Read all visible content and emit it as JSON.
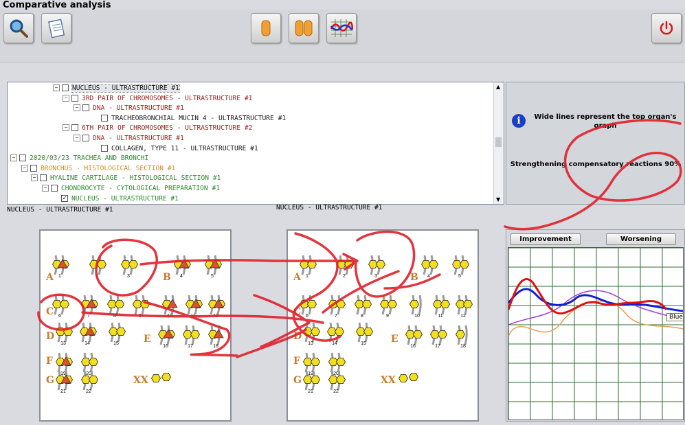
{
  "window": {
    "title": "Comparative analysis"
  },
  "toolbar": {
    "buttons": [
      {
        "name": "search-button",
        "icon": "magnifier-icon"
      },
      {
        "name": "notes-button",
        "icon": "notepad-icon"
      },
      {
        "name": "single-view-button",
        "icon": "single-capsule-icon"
      },
      {
        "name": "dual-view-button",
        "icon": "double-capsule-icon"
      },
      {
        "name": "graph-view-button",
        "icon": "wave-graph-icon"
      },
      {
        "name": "power-button",
        "icon": "power-icon"
      }
    ]
  },
  "tree": {
    "rows": [
      {
        "text": "NUCLEUS - ULTRASTRUCTURE #1",
        "color": "#1a1a1a",
        "indent": 66,
        "expander": true,
        "selected": true
      },
      {
        "text": "3RD PAIR OF CHROMOSOMES - ULTRASTRUCTURE #1",
        "color": "#a32020",
        "indent": 80,
        "expander": true
      },
      {
        "text": "DNA - ULTRASTRUCTURE #1",
        "color": "#a32020",
        "indent": 96,
        "expander": true
      },
      {
        "text": "TRACHEOBRONCHIAL MUCIN 4 - ULTRASTRUCTURE #1",
        "color": "#1a1a1a",
        "indent": 124,
        "expander": false
      },
      {
        "text": "6TH PAIR OF CHROMOSOMES - ULTRASTRUCTURE #2",
        "color": "#a32020",
        "indent": 80,
        "expander": true
      },
      {
        "text": "DNA - ULTRASTRUCTURE #1",
        "color": "#a32020",
        "indent": 96,
        "expander": true
      },
      {
        "text": "COLLAGEN, TYPE 11 - ULTRASTRUCTURE #1",
        "color": "#1a1a1a",
        "indent": 124,
        "expander": false
      },
      {
        "text": "2020/03/23  TRACHEA  AND  BRONCHI",
        "color": "#2a8a2a",
        "indent": 4,
        "expander": true
      },
      {
        "text": "BRONCHUS - HISTOLOGICAL SECTION #1",
        "color": "#d2891f",
        "indent": 20,
        "expander": true
      },
      {
        "text": "HYALINE CARTILAGE - HISTOLOGICAL SECTION #1",
        "color": "#2a8a2a",
        "indent": 34,
        "expander": true
      },
      {
        "text": "CHONDROCYTE - CYTOLOGICAL PREPARATION #1",
        "color": "#2a8a2a",
        "indent": 50,
        "expander": true
      },
      {
        "text": "NUCLEUS - ULTRASTRUCTURE #1",
        "color": "#2a8a2a",
        "indent": 66,
        "expander": false,
        "checked": true
      }
    ]
  },
  "info": {
    "icon": "info-icon",
    "note": "Wide lines represent the top organ's graph",
    "status": "Strengthening compensatory reactions 90%"
  },
  "captions": {
    "left": "NUCLEUS - ULTRASTRUCTURE #1",
    "right": "NUCLEUS - ULTRASTRUCTURE #1"
  },
  "karyotype": {
    "groups": [
      "A",
      "B",
      "C",
      "D",
      "E",
      "F",
      "G"
    ],
    "sex_label": "XX",
    "numbers": [
      "1",
      "2",
      "3",
      "4",
      "5",
      "6",
      "7",
      "8",
      "9",
      "10",
      "11",
      "12",
      "13",
      "14",
      "15",
      "16",
      "17",
      "18",
      "19",
      "20",
      "21",
      "22"
    ]
  },
  "graph": {
    "improvement_label": "Improvement",
    "worsening_label": "Worsening",
    "tooltip": "Blueto",
    "colors": {
      "red": "#e01010",
      "blue": "#1020d0",
      "purple": "#a040d0",
      "orange": "#e0a050",
      "grid": "#2e6b2e"
    }
  }
}
